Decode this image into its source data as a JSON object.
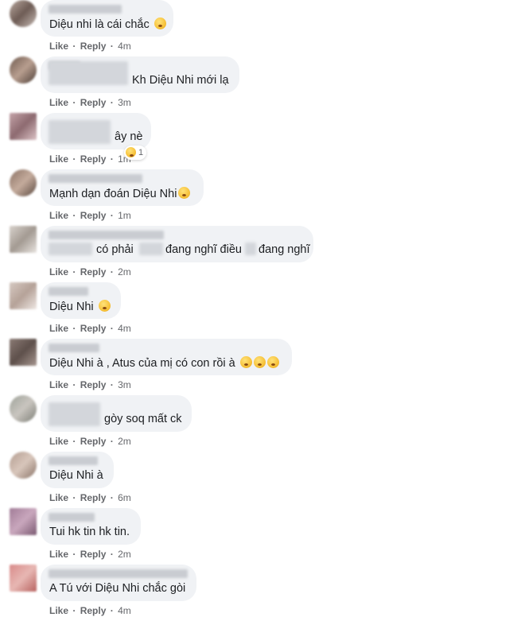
{
  "actions": {
    "like": "Like",
    "reply": "Reply",
    "separator": "·"
  },
  "comments": [
    {
      "text": "Diệu nhi là cái chắc",
      "time": "4m",
      "emoji": "face-emoji"
    },
    {
      "text": "Kh Diệu Nhi mới lạ",
      "time": "3m"
    },
    {
      "text": "ây nè",
      "time": "1m",
      "reaction_count": "1",
      "reaction_icon": "sad-face-emoji"
    },
    {
      "text": "Mạnh dạn đoán Diệu Nhi",
      "time": "1m",
      "emoji": "tongue-face-emoji"
    },
    {
      "text_a": "có phải",
      "text_b": "đang nghĩ điều",
      "text_c": "đang nghĩ",
      "time": "2m"
    },
    {
      "text": "Diệu Nhi",
      "time": "4m",
      "emoji": "thinking-face-emoji"
    },
    {
      "text": "Diệu Nhi à , Atus của mị có con rồi à",
      "time": "3m",
      "emoji": "surprised-face-emoji"
    },
    {
      "text": "gòy soq mất ck",
      "time": "2m"
    },
    {
      "text": "Diệu Nhi à",
      "time": "6m"
    },
    {
      "text": "Tui hk tin hk tin.",
      "time": "2m"
    },
    {
      "text": "A Tú với Diệu Nhi chắc gòi",
      "time": "4m"
    }
  ],
  "colors": {
    "bubble": "#f0f2f5",
    "meta": "#65676b"
  }
}
